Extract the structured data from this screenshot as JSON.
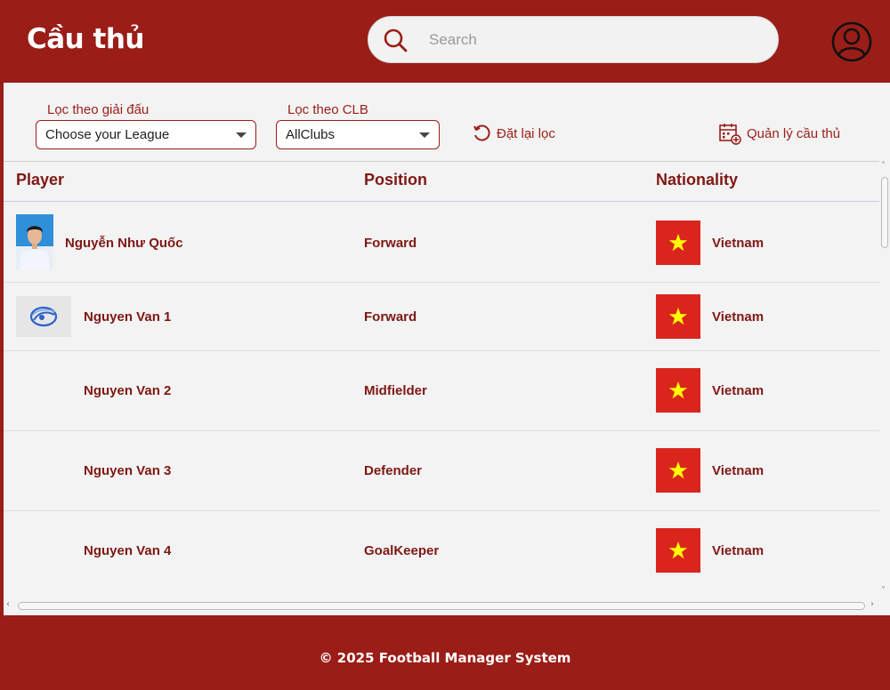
{
  "header": {
    "title": "Cầu thủ",
    "search_placeholder": "Search"
  },
  "filters": {
    "league_label": "Lọc theo giải đấu",
    "league_value": "Choose your League",
    "club_label": "Lọc theo CLB",
    "club_value": "AllClubs",
    "reset_label": "Đặt lại lọc",
    "manage_label": "Quản lý cầu thủ"
  },
  "table": {
    "columns": [
      "Player",
      "Position",
      "Nationality"
    ],
    "rows": [
      {
        "name": "Nguyễn Như Quốc",
        "position": "Forward",
        "nationality": "Vietnam"
      },
      {
        "name": "Nguyen Van 1",
        "position": "Forward",
        "nationality": "Vietnam"
      },
      {
        "name": "Nguyen Van 2",
        "position": "Midfielder",
        "nationality": "Vietnam"
      },
      {
        "name": "Nguyen Van 3",
        "position": "Defender",
        "nationality": "Vietnam"
      },
      {
        "name": "Nguyen Van 4",
        "position": "GoalKeeper",
        "nationality": "Vietnam"
      }
    ]
  },
  "footer": {
    "text": "© 2025 Football Manager System"
  },
  "colors": {
    "brand": "#9b1d18",
    "text_accent": "#7e1813",
    "flag_red": "#da251d",
    "flag_star": "#ffff00"
  }
}
